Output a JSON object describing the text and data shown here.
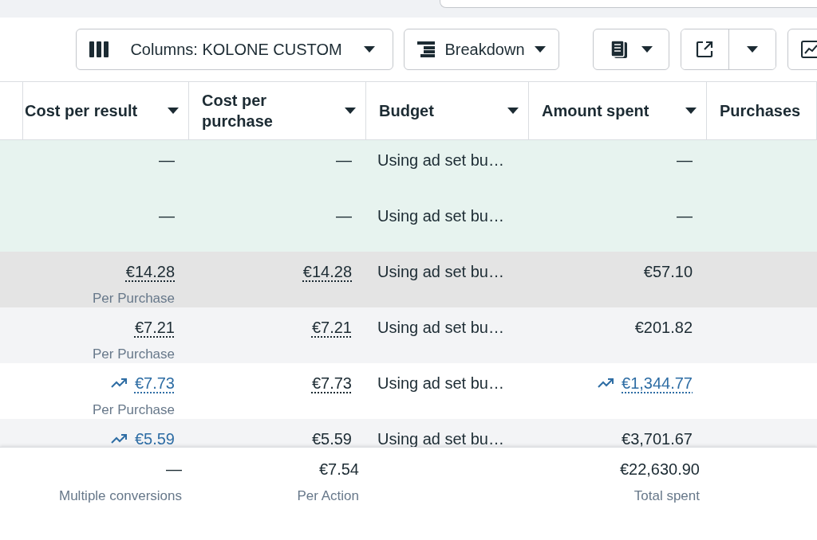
{
  "toolbar": {
    "buttons": [
      {
        "kind": "columns",
        "label": "Columns: KOLONE CUSTOM"
      },
      {
        "kind": "breakdown",
        "label": "Breakdown"
      },
      {
        "kind": "reports"
      },
      {
        "kind": "export"
      },
      {
        "kind": "chart"
      }
    ]
  },
  "table": {
    "columns": [
      {
        "label": "Cost per result",
        "menu": true
      },
      {
        "label": "Cost per purchase",
        "menu": true
      },
      {
        "label": "Budget",
        "menu": true
      },
      {
        "label": "Amount spent",
        "menu": true
      },
      {
        "label": "Purchases",
        "menu": false
      }
    ],
    "rows": [
      {
        "tinted": true,
        "hovered": false,
        "cells": [
          {
            "kind": "plain",
            "text": "—"
          },
          {
            "kind": "plain",
            "text": "—"
          },
          {
            "kind": "text",
            "text": "Using ad set bu…"
          },
          {
            "kind": "plain",
            "text": "—"
          }
        ]
      },
      {
        "tinted": true,
        "hovered": false,
        "cells": [
          {
            "kind": "plain",
            "text": "—"
          },
          {
            "kind": "plain",
            "text": "—"
          },
          {
            "kind": "text",
            "text": "Using ad set bu…"
          },
          {
            "kind": "plain",
            "text": "—"
          }
        ]
      },
      {
        "tinted": false,
        "hovered": true,
        "cells": [
          {
            "kind": "dotted",
            "text": "€14.28",
            "sub": "Per Purchase"
          },
          {
            "kind": "dotted",
            "text": "€14.28"
          },
          {
            "kind": "text",
            "text": "Using ad set bu…"
          },
          {
            "kind": "plain",
            "text": "€57.10"
          }
        ]
      },
      {
        "tinted": false,
        "hovered": false,
        "cells": [
          {
            "kind": "dotted",
            "text": "€7.21",
            "sub": "Per Purchase"
          },
          {
            "kind": "dotted",
            "text": "€7.21"
          },
          {
            "kind": "text",
            "text": "Using ad set bu…"
          },
          {
            "kind": "plain",
            "text": "€201.82"
          }
        ]
      },
      {
        "tinted": false,
        "hovered": false,
        "cells": [
          {
            "kind": "trend",
            "text": "€7.73",
            "sub": "Per Purchase"
          },
          {
            "kind": "dotted",
            "text": "€7.73"
          },
          {
            "kind": "text",
            "text": "Using ad set bu…"
          },
          {
            "kind": "trend",
            "text": "€1,344.77"
          }
        ]
      },
      {
        "tinted": false,
        "hovered": false,
        "cells": [
          {
            "kind": "trend",
            "text": "€5.59"
          },
          {
            "kind": "dotted",
            "text": "€5.59"
          },
          {
            "kind": "text",
            "text": "Using ad set bu…"
          },
          {
            "kind": "plain",
            "text": "€3,701.67"
          }
        ]
      }
    ],
    "totals": [
      {
        "kind": "total",
        "value": "—",
        "caption": "Multiple conversions"
      },
      {
        "kind": "total",
        "value": "€7.54",
        "caption": "Per Action"
      },
      {
        "kind": "empty"
      },
      {
        "kind": "total",
        "value": "€22,630.90",
        "caption": "Total spent"
      }
    ]
  }
}
